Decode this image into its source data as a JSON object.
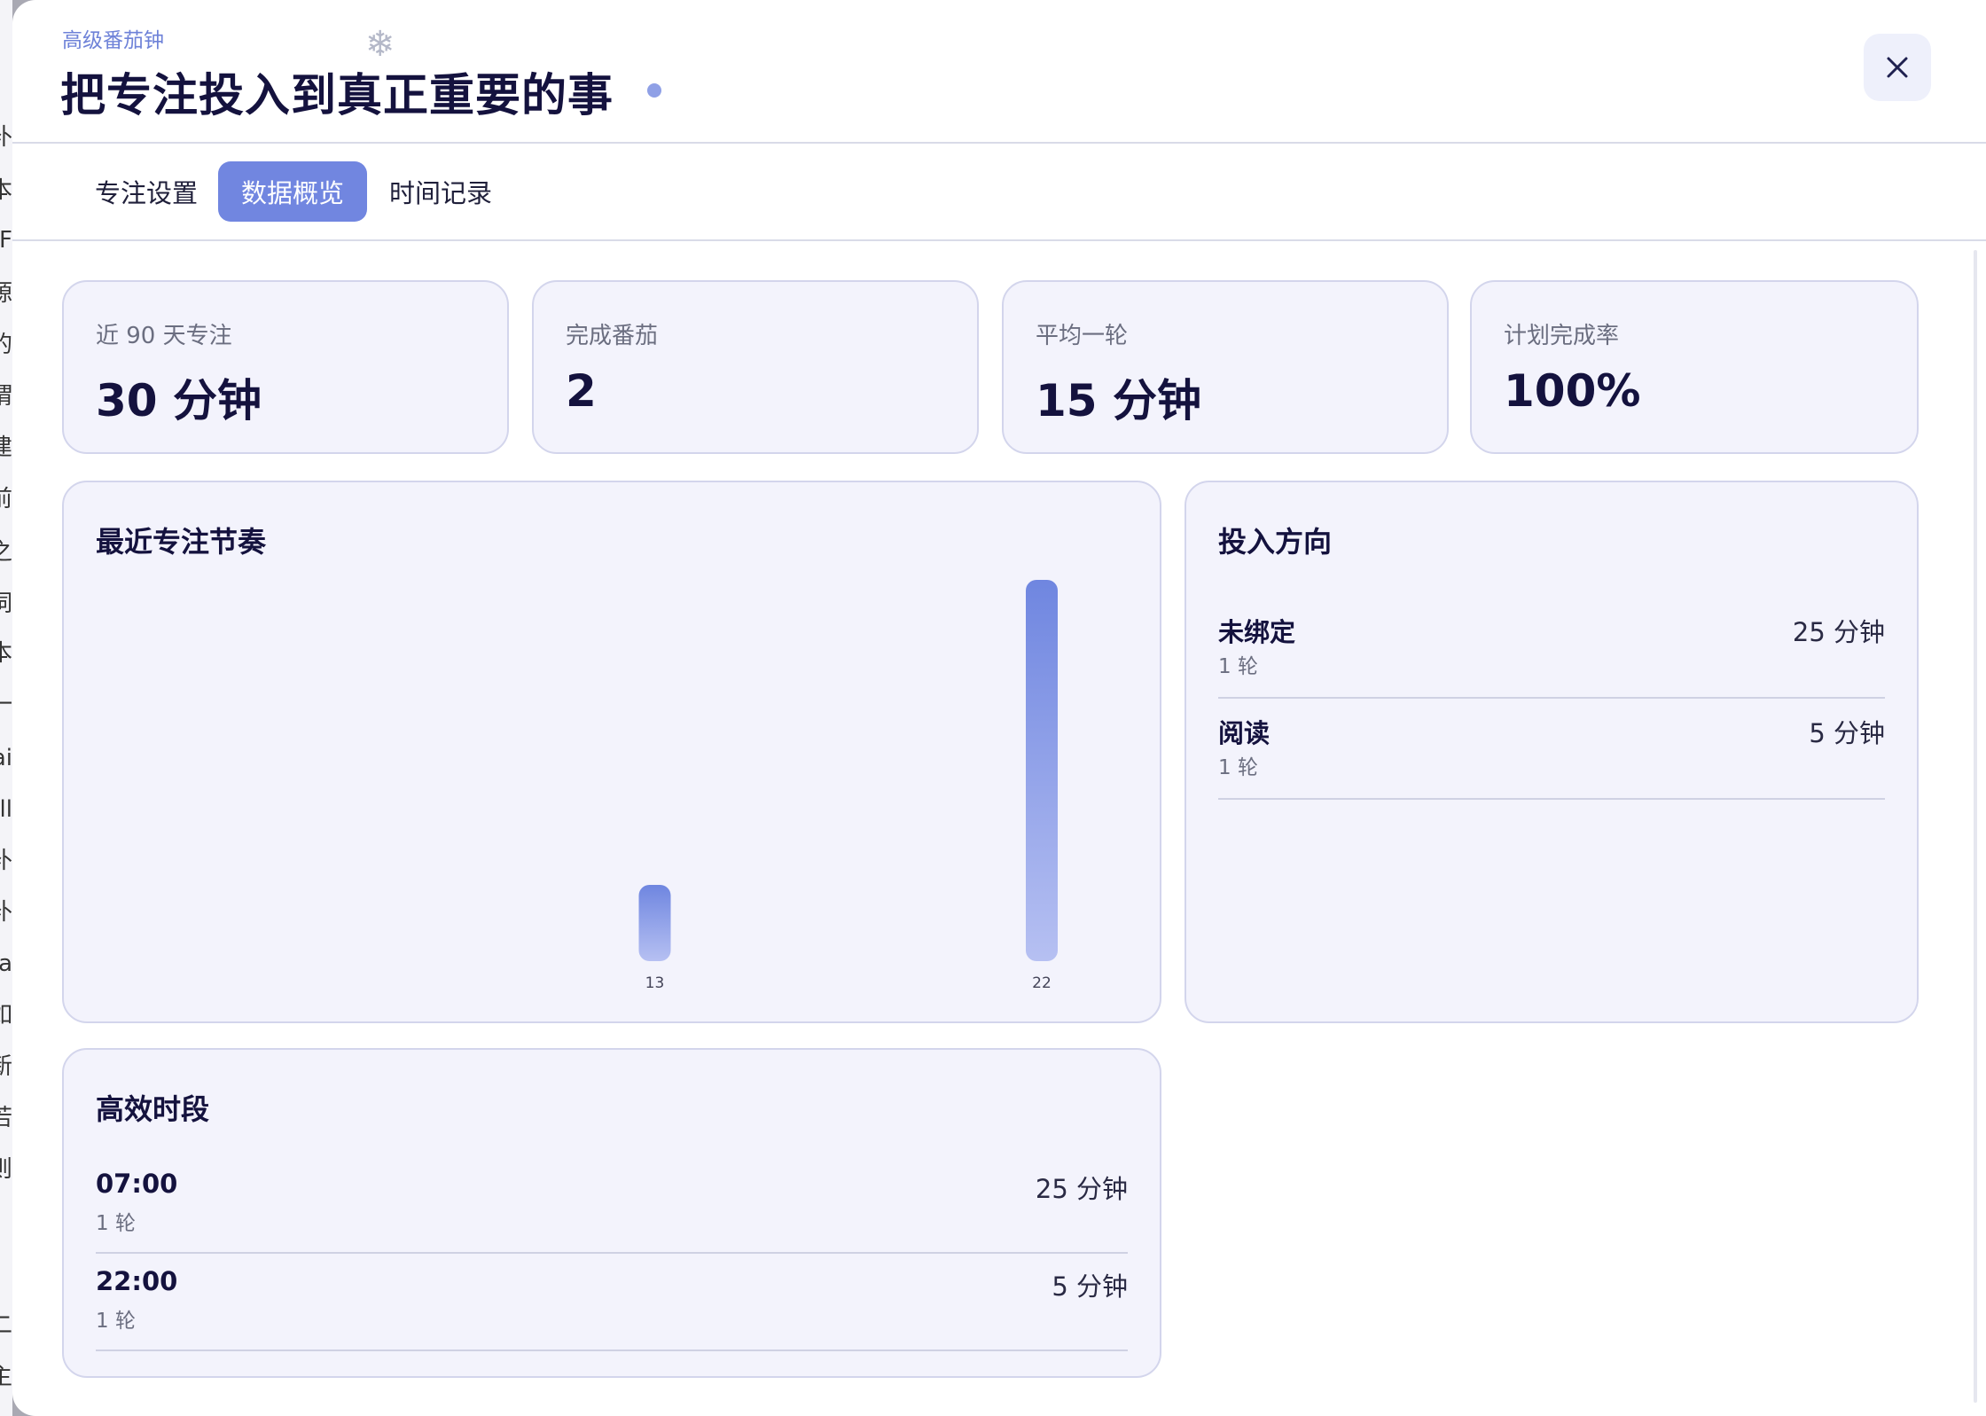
{
  "background_edge": [
    "补",
    "本",
    "F",
    "源",
    "的",
    "谓",
    "建",
    "前",
    "之",
    "词",
    "本",
    "一",
    "ai",
    "ll",
    "补",
    "补",
    "ra",
    "如",
    "新",
    "若",
    "则",
    "二",
    "主"
  ],
  "header": {
    "eyebrow": "高级番茄钟",
    "title": "把专注投入到真正重要的事",
    "close_icon": "close-icon"
  },
  "tabs": [
    {
      "label": "专注设置",
      "active": false
    },
    {
      "label": "数据概览",
      "active": true
    },
    {
      "label": "时间记录",
      "active": false
    }
  ],
  "stats": [
    {
      "label": "近 90 天专注",
      "value": "30 分钟"
    },
    {
      "label": "完成番茄",
      "value": "2"
    },
    {
      "label": "平均一轮",
      "value": "15 分钟"
    },
    {
      "label": "计划完成率",
      "value": "100%"
    }
  ],
  "rhythm": {
    "title": "最近专注节奏",
    "chart_data": {
      "type": "bar",
      "categories": [
        "13",
        "22"
      ],
      "values": [
        5,
        25
      ],
      "colors": {
        "top": "#6f86e0",
        "bottom": "#b6c0f2"
      }
    }
  },
  "direction": {
    "title": "投入方向",
    "items": [
      {
        "name": "未绑定",
        "sub": "1 轮",
        "value": "25 分钟"
      },
      {
        "name": "阅读",
        "sub": "1 轮",
        "value": "5 分钟"
      }
    ]
  },
  "peak": {
    "title": "高效时段",
    "items": [
      {
        "name": "07:00",
        "sub": "1 轮",
        "value": "25 分钟"
      },
      {
        "name": "22:00",
        "sub": "1 轮",
        "value": "5 分钟"
      }
    ]
  }
}
